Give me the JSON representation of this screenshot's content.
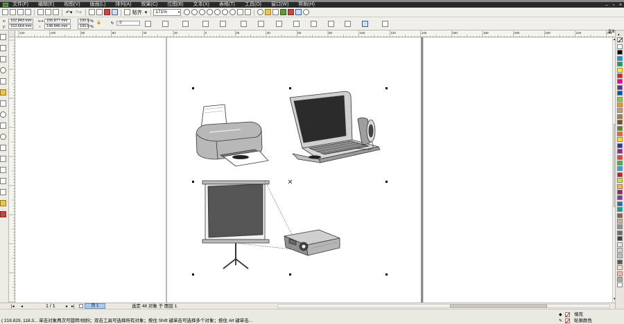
{
  "menu": {
    "items": [
      "文件(F)",
      "编辑(E)",
      "视图(V)",
      "版面(L)",
      "排列(A)",
      "效果(C)",
      "位图(B)",
      "文本(X)",
      "表格(T)",
      "工具(O)",
      "窗口(W)",
      "帮助(H)"
    ]
  },
  "toolbar": {
    "snap_label": "贴齐",
    "zoom_value": "171%"
  },
  "property_bar": {
    "x_label": "x:",
    "x_value": "102.843 mm",
    "y_label": "y:",
    "y_value": "153.664 mm",
    "width_value": "155.877 mm",
    "height_value": "148.846 mm",
    "scale_x": "100.0",
    "scale_y": "100.0",
    "percent": "%",
    "rotation": ".0"
  },
  "rulers": {
    "horizontal_ticks": [
      "120",
      "100",
      "80",
      "60",
      "40",
      "20",
      "0",
      "20",
      "40",
      "60",
      "80",
      "100",
      "120",
      "140",
      "160",
      "180",
      "200",
      "220",
      "240",
      "260",
      "280"
    ],
    "horizontal_unit": "毫米"
  },
  "page_nav": {
    "page_count": "1 / 1",
    "page_tab": "页 1"
  },
  "status": {
    "selection": "选定 48 对象 于 图层 1",
    "coordinates": "( 218.829, 118.3...",
    "hint": "单击对象两次可旋转/倾斜；双击工具可选择所有对象；按住 Shift 键单击可选择多个对象；按住 Alt 键单击...",
    "fill_label": "填充",
    "outline_label": "轮廓颜色"
  },
  "palette_colors": [
    "#ffffff",
    "#000000",
    "#00a0e9",
    "#00a651",
    "#fff200",
    "#ed1c24",
    "#ec008c",
    "#662d91",
    "#0054a6",
    "#8dc63f",
    "#f7941d",
    "#c69c6d",
    "#a67c52",
    "#754c24",
    "#598527",
    "#f26522",
    "#ffde17",
    "#2e3192",
    "#92278f",
    "#ef4136",
    "#39b54a",
    "#27aae1",
    "#be1e2d",
    "#d7df23",
    "#fbb040",
    "#9e1f63",
    "#7f3f98",
    "#1c75bc",
    "#00a79d",
    "#8b5e3c",
    "#c2b59b",
    "#939598",
    "#6d6e71",
    "#414042",
    "#e6e7e8",
    "#d1d3d4",
    "#bcbec0",
    "#58595b",
    "#fddcc6",
    "#f6b6a9",
    "#a7a9ac",
    "#ffffff"
  ],
  "toolbox_icons": [
    "pick-tool-icon",
    "shape-tool-icon",
    "crop-tool-icon",
    "zoom-tool-icon",
    "freehand-tool-icon",
    "smart-fill-icon",
    "rectangle-tool-icon",
    "ellipse-tool-icon",
    "polygon-tool-icon",
    "basic-shapes-icon",
    "text-tool-icon",
    "table-tool-icon",
    "blend-tool-icon",
    "eyedropper-tool-icon",
    "outline-tool-icon",
    "fill-tool-icon",
    "interactive-fill-icon"
  ]
}
